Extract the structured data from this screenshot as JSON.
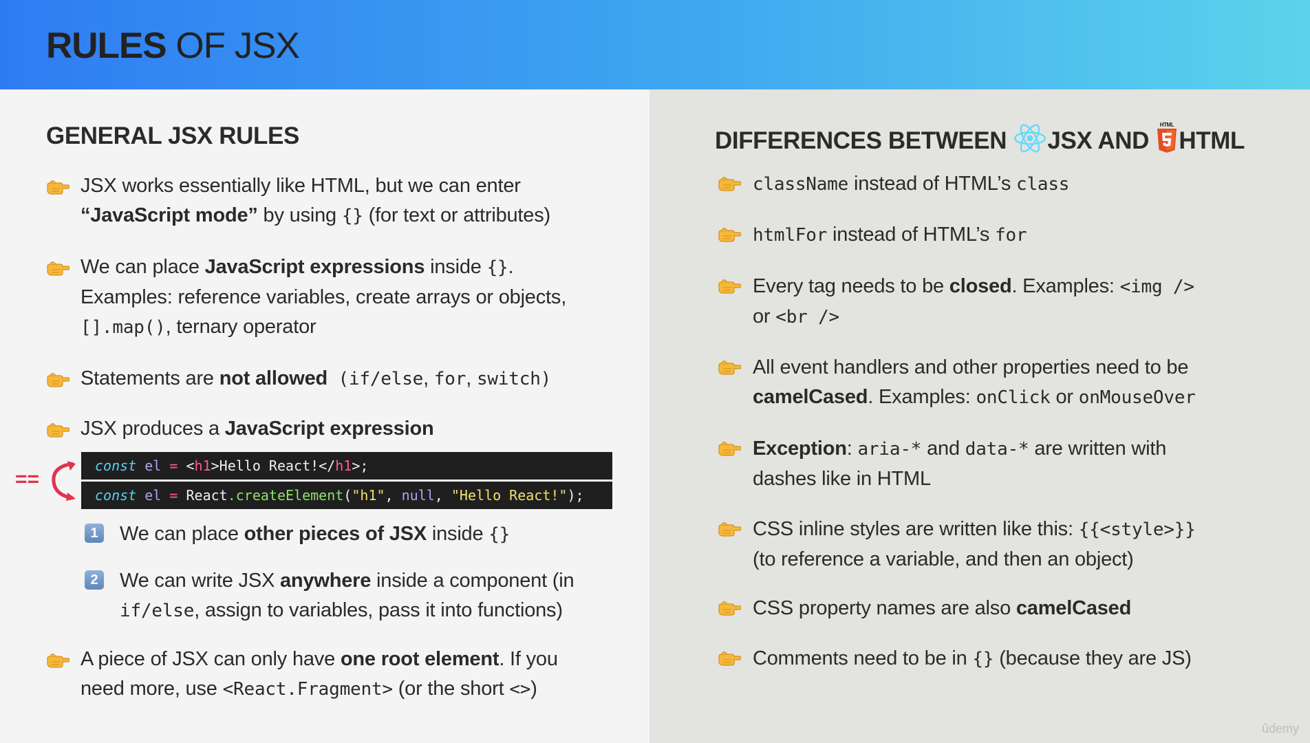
{
  "title": {
    "bold": "RULES",
    "rest": " OF JSX"
  },
  "left": {
    "heading": "GENERAL JSX RULES",
    "r1": {
      "t1": "JSX works essentially like HTML, but we can enter",
      "b1": "“JavaScript mode”",
      "t2": " by using ",
      "c1": "{}",
      "t3": " (for text or attributes)"
    },
    "r2": {
      "t1": "We can place ",
      "b1": "JavaScript expressions",
      "t2": " inside ",
      "c1": "{}",
      "t3": ".",
      "t4": "Examples: reference variables, create arrays or objects,",
      "c2": "[].map()",
      "t5": ", ternary operator"
    },
    "r3": {
      "t1": "Statements are ",
      "b1": "not allowed",
      "c1": " (if/else",
      "t2": ", ",
      "c2": "for",
      "t3": ", ",
      "c3": "switch)"
    },
    "r4": {
      "t1": "JSX produces a ",
      "b1": "JavaScript expression"
    },
    "eq": "==",
    "code1": {
      "kw": "const",
      "var": "el",
      "op": "=",
      "t1": "<",
      "tag1": "h1",
      "t2": ">Hello React!</",
      "tag2": "h1",
      "t3": ">;"
    },
    "code2": {
      "kw": "const",
      "var": "el",
      "op": "=",
      "obj": "React",
      "fn": ".createElement",
      "p1": "(",
      "s1": "\"h1\"",
      "p2": ", ",
      "null": "null",
      "p3": ", ",
      "s2": "\"Hello React!\"",
      "p4": ");"
    },
    "s1": {
      "badge": "1",
      "t1": "We can place ",
      "b1": "other pieces of JSX",
      "t2": " inside ",
      "c1": "{}"
    },
    "s2": {
      "badge": "2",
      "t1": "We can write JSX ",
      "b1": "anywhere",
      "t2": " inside a component (in",
      "c1": "if/else",
      "t3": ", assign to variables, pass it into functions)"
    },
    "r5": {
      "t1": "A piece of JSX can only have ",
      "b1": "one root element",
      "t2": ". If you",
      "t3": "need more, use ",
      "c1": "<React.Fragment>",
      "t4": " (or the short ",
      "c2": " <>",
      "t5": ")"
    }
  },
  "right": {
    "heading": {
      "t1": "DIFFERENCES BETWEEN",
      "t2": "JSX AND",
      "html5_label": "HTML",
      "t3": "HTML"
    },
    "r1": {
      "c1": "className",
      "t1": " instead of HTML’s ",
      "c2": "class"
    },
    "r2": {
      "c1": "htmlFor",
      "t1": " instead of HTML’s ",
      "c2": "for"
    },
    "r3": {
      "t1": "Every tag needs to be ",
      "b1": "closed",
      "t2": ". Examples: ",
      "c1": "<img />",
      "t3": "or ",
      "c2": "<br />"
    },
    "r4": {
      "t1": "All event handlers and other properties need to be",
      "b1": "camelCased",
      "t2": ". Examples: ",
      "c1": "onClick",
      "t3": " or ",
      "c2": "onMouseOver"
    },
    "r5": {
      "b1": "Exception",
      "t1": ": ",
      "c1": "aria-*",
      "t2": " and ",
      "c2": "data-*",
      "t3": " are written with",
      "t4": "dashes like in HTML"
    },
    "r6": {
      "t1": "CSS inline styles are written like this: ",
      "c1": "{{<style>}}",
      "t2": "(to reference a variable, and then an object)"
    },
    "r7": {
      "t1": "CSS property names are also ",
      "b1": "camelCased"
    },
    "r8": {
      "t1": "Comments need to be in ",
      "c1": "{}",
      "t2": " (because they are JS)"
    }
  },
  "watermark": "ûdemy"
}
